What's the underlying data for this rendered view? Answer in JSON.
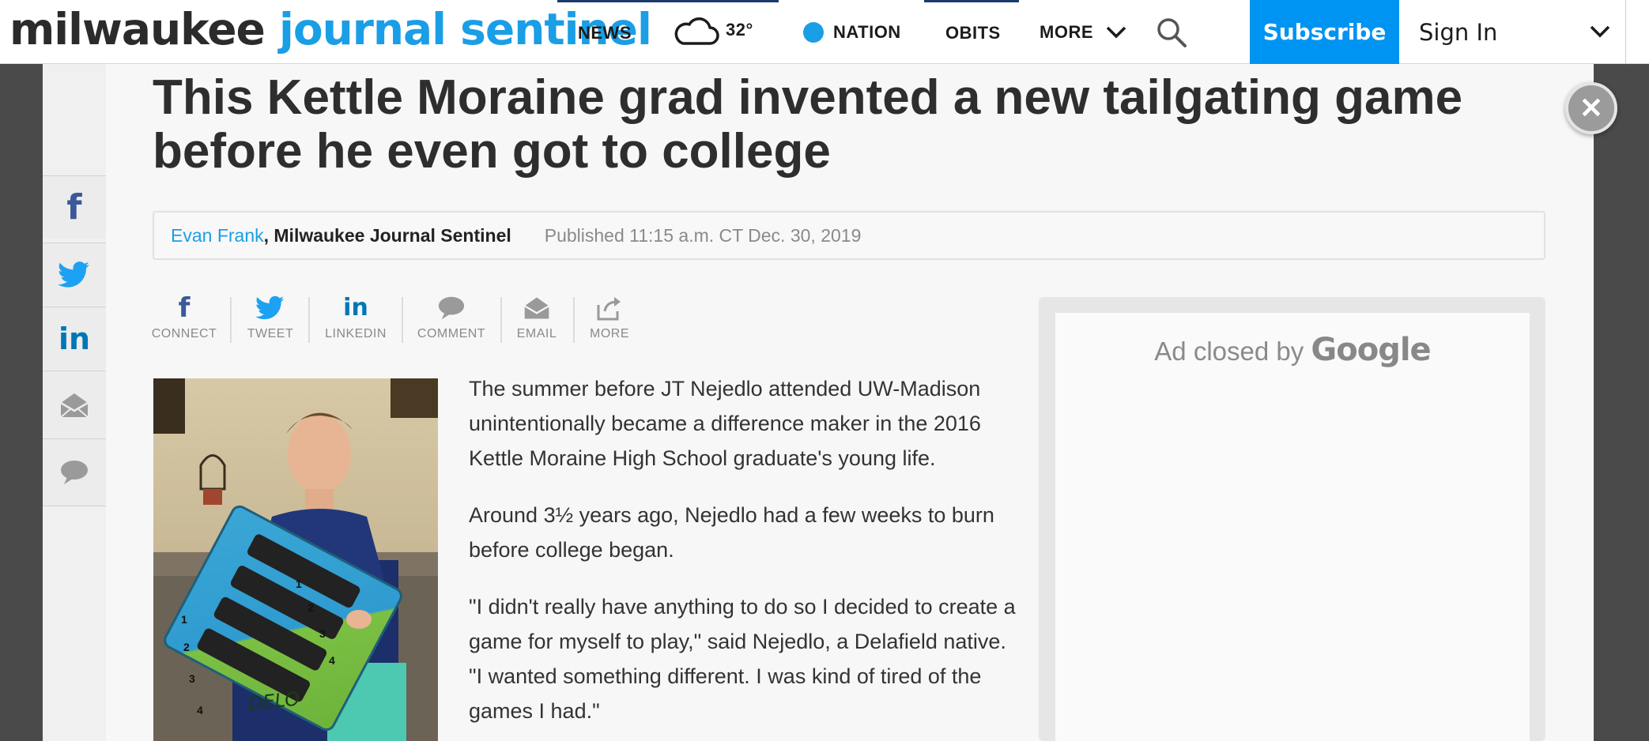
{
  "brand": {
    "part1": "milwaukee",
    "part2": "journal sentinel"
  },
  "nav": {
    "news": "NEWS",
    "temp": "32°",
    "nation": "NATION",
    "obits": "OBITS",
    "more": "MORE",
    "subscribe": "Subscribe",
    "signin": "Sign In"
  },
  "article": {
    "headline": "This Kettle Moraine grad invented a new tailgating game before he even got to college",
    "author": "Evan Frank",
    "outlet_sep": ", ",
    "outlet": "Milwaukee Journal Sentinel",
    "published": "Published 11:15 a.m. CT Dec. 30, 2019",
    "paragraphs": [
      "The summer before JT Nejedlo attended UW-Madison unintentionally became a difference maker in the 2016 Kettle Moraine High School graduate's young life.",
      "Around 3½ years ago, Nejedlo had a few weeks to burn before college began.",
      "\"I didn't really have anything to do so I decided to create a game for myself to play,\" said Nejedlo, a Delafield native. \"I wanted something different. I was kind of tired of the games I had.\""
    ]
  },
  "share": {
    "connect": "CONNECT",
    "tweet": "TWEET",
    "linkedin": "LINKEDIN",
    "comment": "COMMENT",
    "email": "EMAIL",
    "more": "MORE"
  },
  "ad": {
    "closed_by": "Ad closed by",
    "google": "Google"
  },
  "photo": {
    "board_text": "DELO",
    "numbers": [
      "1",
      "2",
      "3",
      "4",
      "1",
      "2",
      "3",
      "4"
    ]
  },
  "colors": {
    "brand_blue": "#1a9ee6",
    "subscribe_bg": "#0094f2",
    "facebook": "#3b5998",
    "twitter": "#1da1f2",
    "linkedin": "#0077b5"
  }
}
